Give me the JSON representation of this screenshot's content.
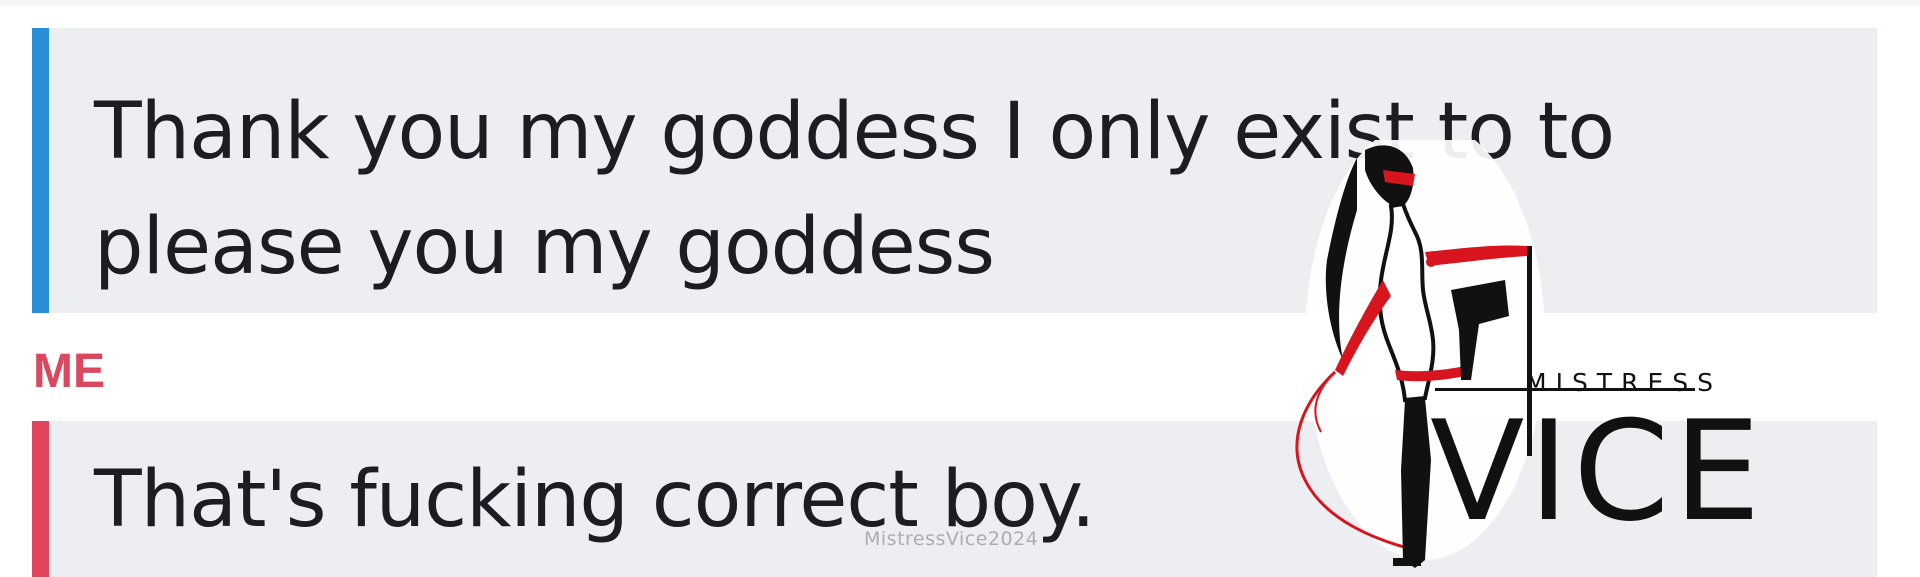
{
  "colors": {
    "them_bar": "#2a8fd8",
    "me_bar": "#e0445e",
    "me_label": "#d9485e",
    "bubble_bg": "#eceef2",
    "text": "#1b1d22"
  },
  "conversation": {
    "messages": [
      {
        "sender": "them",
        "text": "Thank you my goddess I only exist to to please you my goddess"
      },
      {
        "sender_label": "ME",
        "text": "That's fucking correct boy."
      }
    ]
  },
  "watermark": {
    "small": "MistressVice2024",
    "logo_top": "MISTRESS",
    "logo_main": "VICE"
  }
}
